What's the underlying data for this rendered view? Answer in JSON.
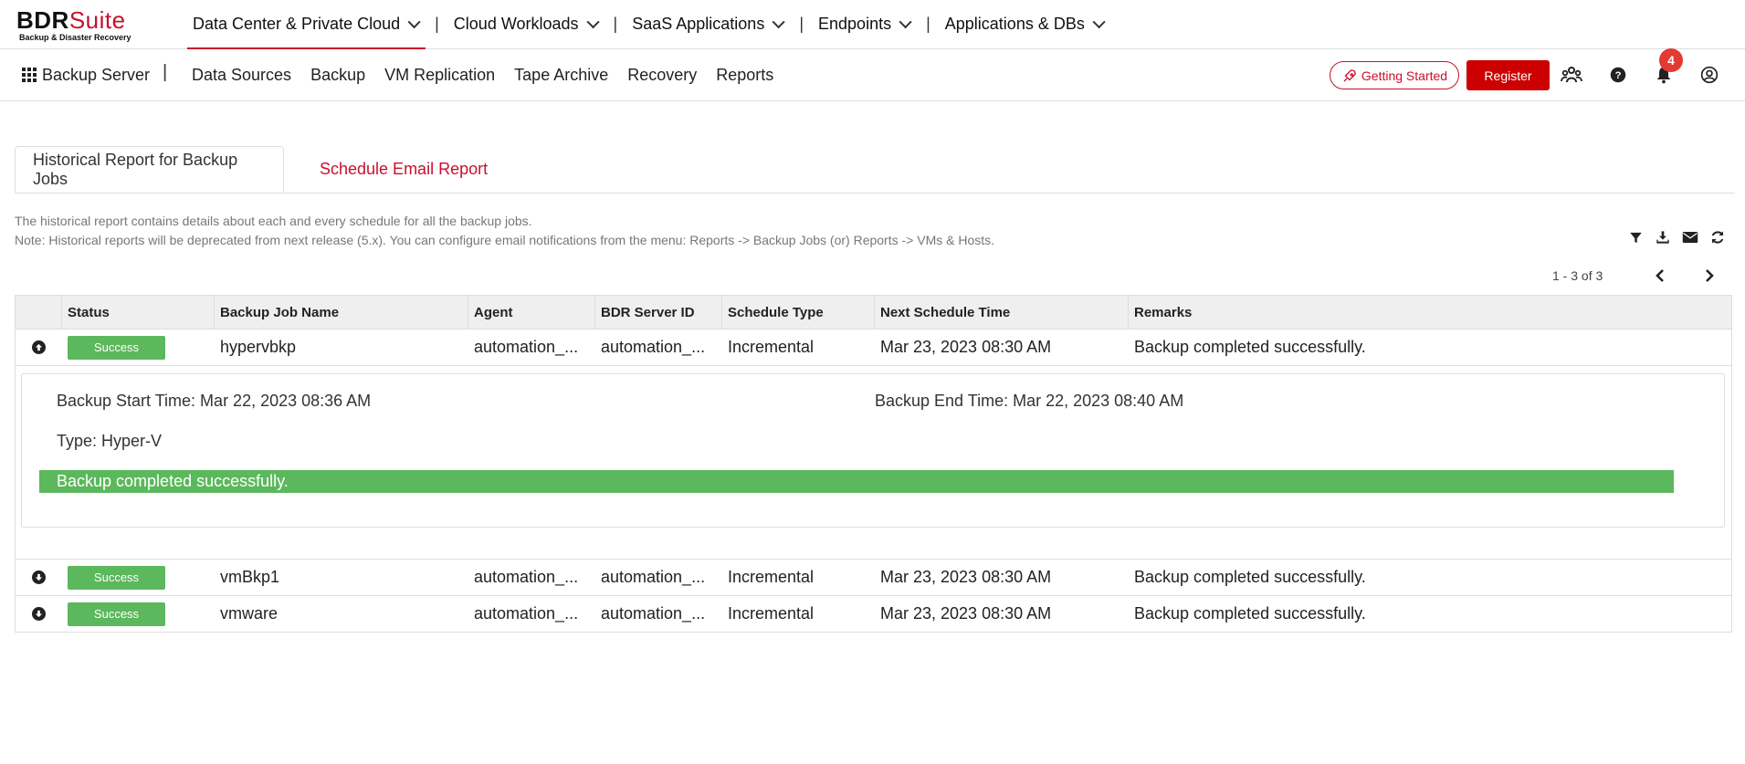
{
  "logo": {
    "brand_part1": "BDR",
    "brand_part2": "Suite",
    "tagline": "Backup & Disaster Recovery"
  },
  "top_nav": [
    {
      "label": "Data Center & Private Cloud"
    },
    {
      "label": "Cloud Workloads"
    },
    {
      "label": "SaaS Applications"
    },
    {
      "label": "Endpoints"
    },
    {
      "label": "Applications & DBs"
    }
  ],
  "top_nav_separator": "|",
  "app_menu": {
    "label": "Backup Server",
    "separator": "|"
  },
  "sub_nav": [
    {
      "label": "Data Sources"
    },
    {
      "label": "Backup"
    },
    {
      "label": "VM Replication"
    },
    {
      "label": "Tape Archive"
    },
    {
      "label": "Recovery"
    },
    {
      "label": "Reports"
    }
  ],
  "header_actions": {
    "getting_started": "Getting Started",
    "register": "Register",
    "notification_count": "4",
    "icons": [
      "team-icon",
      "help-icon",
      "bell-icon",
      "user-icon"
    ]
  },
  "tabs": [
    {
      "label": "Historical Report for Backup Jobs"
    },
    {
      "label": "Schedule Email Report"
    }
  ],
  "notes": {
    "line1": "The historical report contains details about each and every schedule for all the backup jobs.",
    "line2": "Note: Historical reports will be deprecated from next release (5.x). You can configure email notifications from the menu: Reports -> Backup Jobs (or) Reports -> VMs & Hosts."
  },
  "toolbar_icons": [
    "filter-icon",
    "download-icon",
    "email-icon",
    "refresh-icon"
  ],
  "pagination": {
    "label": "1 - 3 of 3"
  },
  "table": {
    "headers": [
      "",
      "Status",
      "Backup Job Name",
      "Agent",
      "BDR Server ID",
      "Schedule Type",
      "Next Schedule Time",
      "Remarks"
    ],
    "rows": [
      {
        "expanded": true,
        "status": "Success",
        "job": "hypervbkp",
        "agent": "automation_...",
        "server": "automation_...",
        "type": "Incremental",
        "next": "Mar 23, 2023 08:30 AM",
        "remarks": "Backup completed successfully."
      },
      {
        "expanded": false,
        "status": "Success",
        "job": "vmBkp1",
        "agent": "automation_...",
        "server": "automation_...",
        "type": "Incremental",
        "next": "Mar 23, 2023 08:30 AM",
        "remarks": "Backup completed successfully."
      },
      {
        "expanded": false,
        "status": "Success",
        "job": "vmware",
        "agent": "automation_...",
        "server": "automation_...",
        "type": "Incremental",
        "next": "Mar 23, 2023 08:30 AM",
        "remarks": "Backup completed successfully."
      }
    ],
    "detail": {
      "start": "Backup Start Time: Mar 22, 2023 08:36 AM",
      "end": "Backup End Time: Mar 22, 2023 08:40 AM",
      "type": "Type: Hyper-V",
      "message": "Backup completed successfully."
    }
  },
  "colors": {
    "brand_red": "#c8102e",
    "register_red": "#cc0000",
    "success_green": "#5cb85c",
    "badge_red": "#e53935"
  }
}
